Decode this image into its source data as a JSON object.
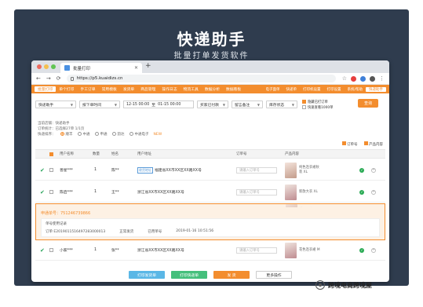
{
  "hero": {
    "title": "快递助手",
    "subtitle": "批量打单发货软件"
  },
  "browser": {
    "tab_label": "批量打印",
    "url": "https://p5.kuaidizs.cn",
    "traffic_colors": [
      "#ed6a5e",
      "#f4bf4f",
      "#61c554"
    ]
  },
  "nav": {
    "items": [
      "批量打印",
      "单个打印",
      "手工订单",
      "常用模板",
      "发货单",
      "商品管理",
      "操作日志",
      "物流工具",
      "数据分析",
      "数据看板"
    ],
    "active_index": 0,
    "right_items": [
      "电子面单",
      "快递单",
      "打印机设置",
      "打印设置",
      "系统/帮助",
      "快递助手"
    ],
    "accent": "#f38d2e"
  },
  "filters": {
    "seller_label": "快递助手",
    "time_type": "按下单时间",
    "date_from": "12-15 00:00",
    "date_sep": "至",
    "date_to": "01-15 00:00",
    "status": "买家已付款",
    "remark": "留言备注",
    "stock": "库存状态",
    "opt1": "隐藏已打订单",
    "opt2": "快速查看1000单",
    "search_label": "查询"
  },
  "meta": {
    "line1": "当前店铺：快递助手",
    "line2": "订单统计：已选择27单  1/1页",
    "sort_label": "快递排序：",
    "sort_options": [
      "顺丰",
      "中通",
      "申通",
      "韵达",
      "中通电子"
    ],
    "sort_selected": 0,
    "sort_badge": "NEW",
    "right_opt1": "订单号",
    "right_opt2": "产品内容"
  },
  "table": {
    "headers": [
      "用户名称",
      "数量",
      "姓名",
      "用户地址",
      "订单号",
      "产品内容"
    ],
    "rows": [
      {
        "user": "善星***",
        "qty": "1",
        "name": "陈**",
        "tag": "收货地址",
        "address": "福建省XX市XX区XX路XX号",
        "input_ph": "请输入订单号",
        "product": "纯色连衣裙秋装 XL",
        "alt": false,
        "hl": false
      },
      {
        "user": "陈启***",
        "qty": "1",
        "name": "王**",
        "tag": "",
        "address": "浙江省XX市XX区XX路XX号",
        "input_ph": "请输入订单号",
        "product": "新款大衣 XL",
        "alt": true,
        "hl": false
      },
      {
        "user": "开心***",
        "qty": "1",
        "name": "刘**",
        "tag": "",
        "address": "浙江省XX市XX区XX路XX号",
        "input_ph": "请输入订单号",
        "product": "蓝色牛仔裤 XL X1",
        "alt": false,
        "hl": true
      },
      {
        "user": "小家***",
        "qty": "1",
        "name": "张**",
        "tag": "",
        "address": "浙江省XX市XX区XX路XX号",
        "input_ph": "请输入订单号",
        "product": "花色连衣裙 M",
        "alt": true,
        "hl": false
      }
    ]
  },
  "expand": {
    "ship_no": "申通单号：751246739866",
    "header": "单号使用记录",
    "order_no": "订单  E2019011516497283000013",
    "type": "正常发货",
    "op": "已用单号",
    "time": "2019-01-16 10:51:56"
  },
  "bottom": {
    "btn1": "打印发货单",
    "btn2": "打印快递单",
    "btn3": "发  货",
    "btn4": "更多操作"
  },
  "watermark": {
    "text": "跨境电商跨境屋"
  }
}
